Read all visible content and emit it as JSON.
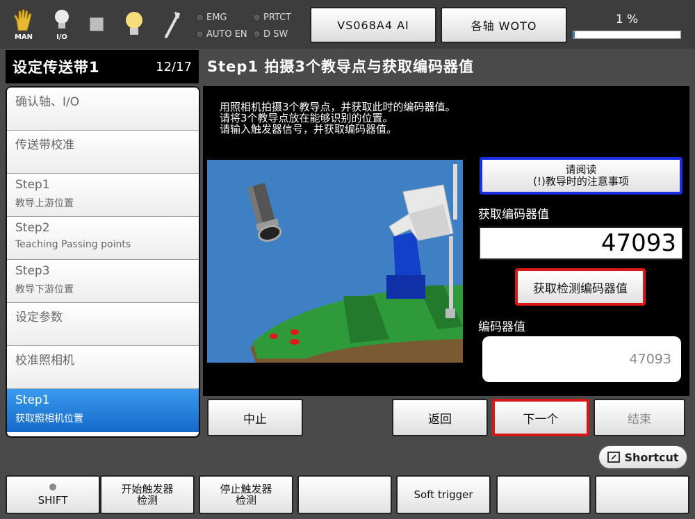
{
  "topbar": {
    "mode_icon_label": "MAN",
    "io_icon_label": "I/O",
    "lamps": [
      {
        "label": "EMG"
      },
      {
        "label": "PRTCT"
      },
      {
        "label": "AUTO EN"
      },
      {
        "label": "D SW"
      }
    ],
    "robot_button": "VS068A4 AI",
    "coord_button": "各轴 WOTO",
    "speed_label": "1 %",
    "speed_percent": 1
  },
  "left_panel": {
    "title": "设定传送带1",
    "page": "12/17",
    "steps": [
      {
        "line1": "确认轴、I/O",
        "line2": ""
      },
      {
        "line1": "传送带校准",
        "line2": ""
      },
      {
        "line1": "Step1",
        "line2": "教导上游位置"
      },
      {
        "line1": "Step2",
        "line2": "Teaching Passing points"
      },
      {
        "line1": "Step3",
        "line2": "教导下游位置"
      },
      {
        "line1": "设定参数",
        "line2": ""
      },
      {
        "line1": "校准照相机",
        "line2": ""
      },
      {
        "line1": "Step1",
        "line2": "获取照相机位置"
      }
    ]
  },
  "main": {
    "title": "Step1 拍摄3个教导点与获取编码器值",
    "description": [
      "用照相机拍摄3个教导点，并获取此时的编码器值。",
      "请将3个教导点放在能够识别的位置。",
      "请输入触发器信号，并获取编码器值。"
    ],
    "notice_button": {
      "line1": "请阅读",
      "line2": "(!)教导时的注意事项"
    },
    "get_encoder_label": "获取编码器值",
    "get_encoder_value": "47093",
    "get_detect_button": "获取检测编码器值",
    "encoder_label": "编码器值",
    "encoder_value": "47093"
  },
  "nav": {
    "abort": "中止",
    "back": "返回",
    "next": "下一个",
    "finish": "结束"
  },
  "shortcut": "Shortcut",
  "function_keys": [
    {
      "line1": "SHIFT",
      "line2": ""
    },
    {
      "line1": "开始触发器",
      "line2": "检测"
    },
    {
      "line1": "停止触发器",
      "line2": "检测"
    },
    {
      "line1": "",
      "line2": ""
    },
    {
      "line1": "Soft trigger",
      "line2": ""
    },
    {
      "line1": "",
      "line2": ""
    },
    {
      "line1": "",
      "line2": ""
    }
  ],
  "colors": {
    "accent_blue": "#1e74d8",
    "highlight_red": "#d81818",
    "notice_blue": "#1a2fe6",
    "conveyor_green": "#2e9a3a",
    "scene_blue": "#3f7fc4"
  }
}
